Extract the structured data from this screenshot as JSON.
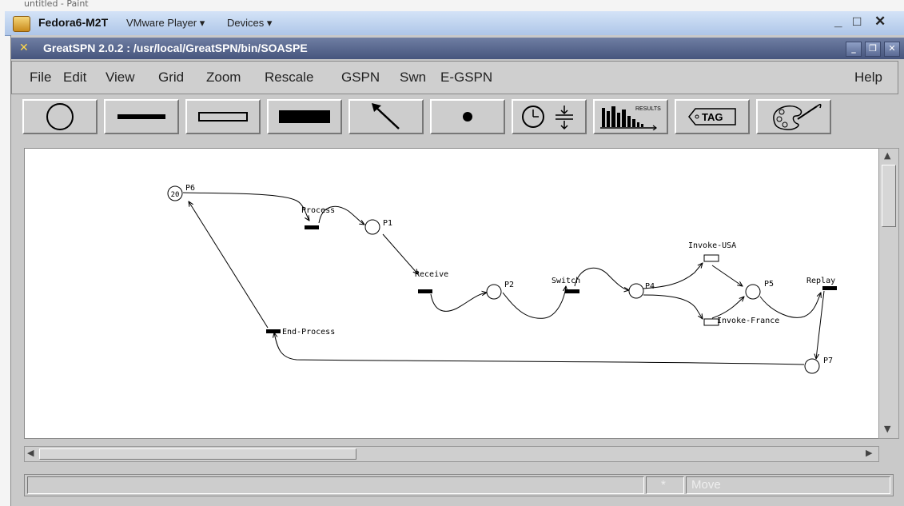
{
  "vmware": {
    "vm_name": "Fedora6-M2T",
    "player_menu": "VMware Player ▾",
    "devices_menu": "Devices ▾",
    "minimize": "_",
    "maximize": "□",
    "close": "✕"
  },
  "app": {
    "title": "GreatSPN 2.0.2 : /usr/local/GreatSPN/bin/SOASPE",
    "menu": [
      "File",
      "Edit",
      "View",
      "Grid",
      "Zoom",
      "Rescale",
      "GSPN",
      "Swn",
      "E-GSPN"
    ],
    "help": "Help",
    "tools": {
      "results_label": "RESULTS",
      "tag_label": "TAG"
    }
  },
  "net": {
    "places": [
      {
        "label": "P6",
        "tokens": "20"
      },
      {
        "label": "P1"
      },
      {
        "label": "P2"
      },
      {
        "label": "P4"
      },
      {
        "label": "P5"
      },
      {
        "label": "P7"
      }
    ],
    "transitions": [
      {
        "label": "Process"
      },
      {
        "label": "Receive"
      },
      {
        "label": "Switch"
      },
      {
        "label": "Invoke-USA"
      },
      {
        "label": "Invoke-France"
      },
      {
        "label": "Replay"
      },
      {
        "label": "End-Process"
      }
    ]
  },
  "status": {
    "star": "*",
    "mode": "Move"
  }
}
